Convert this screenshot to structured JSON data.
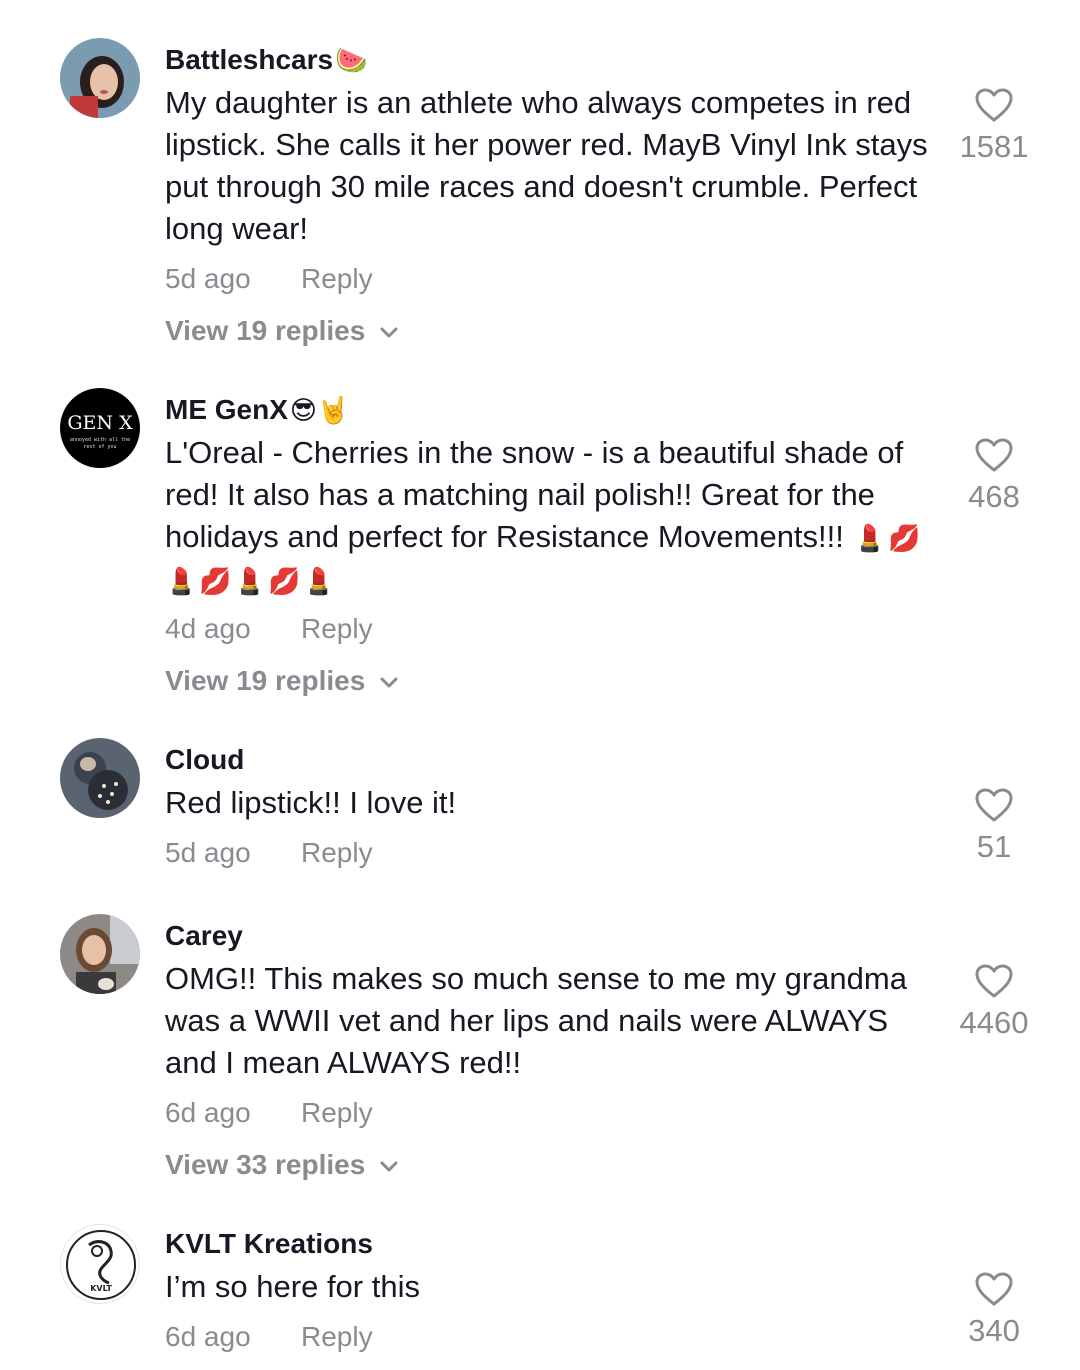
{
  "comments": [
    {
      "username": "Battleshcars",
      "username_emoji": "🍉",
      "avatar": "woman-portrait-avatar",
      "text": "My daughter is an athlete who always competes in red lipstick. She calls it her power red. MayB Vinyl Ink stays put through 30 mile races and doesn't crumble. Perfect long wear!",
      "time": "5d ago",
      "reply_label": "Reply",
      "likes": "1581",
      "view_replies": "View 19 replies"
    },
    {
      "username": "ME GenX",
      "username_emoji": "😎🤘",
      "avatar": "genx-logo-avatar",
      "avatar_text": "GEN X",
      "avatar_subtext_1": "annoyed with all the",
      "avatar_subtext_2": "rest of you",
      "text": "L'Oreal - Cherries in the snow - is a beautiful shade of red! It also has a matching nail polish!! Great for the holidays and perfect for Resistance Movements!!!",
      "text_emoji": "💄💋💄💋💄💋💄",
      "time": "4d ago",
      "reply_label": "Reply",
      "likes": "468",
      "view_replies": "View 19 replies"
    },
    {
      "username": "Cloud",
      "avatar": "fantasy-art-avatar",
      "text": "Red lipstick!! I love it!",
      "time": "5d ago",
      "reply_label": "Reply",
      "likes": "51"
    },
    {
      "username": "Carey",
      "avatar": "woman-selfie-avatar",
      "text": "OMG!! This makes so much sense to me my grandma was a WWII vet and her lips and nails were ALWAYS and I mean ALWAYS red!!",
      "time": "6d ago",
      "reply_label": "Reply",
      "likes": "4460",
      "view_replies": "View 33 replies"
    },
    {
      "username": "KVLT Kreations",
      "avatar": "kvlt-logo-avatar",
      "avatar_text": "KVLT",
      "text": "I’m so here for this",
      "time": "6d ago",
      "reply_label": "Reply",
      "likes": "340"
    }
  ],
  "colors": {
    "primary_text": "#161823",
    "secondary_text": "#8a8b91",
    "background": "#ffffff"
  }
}
